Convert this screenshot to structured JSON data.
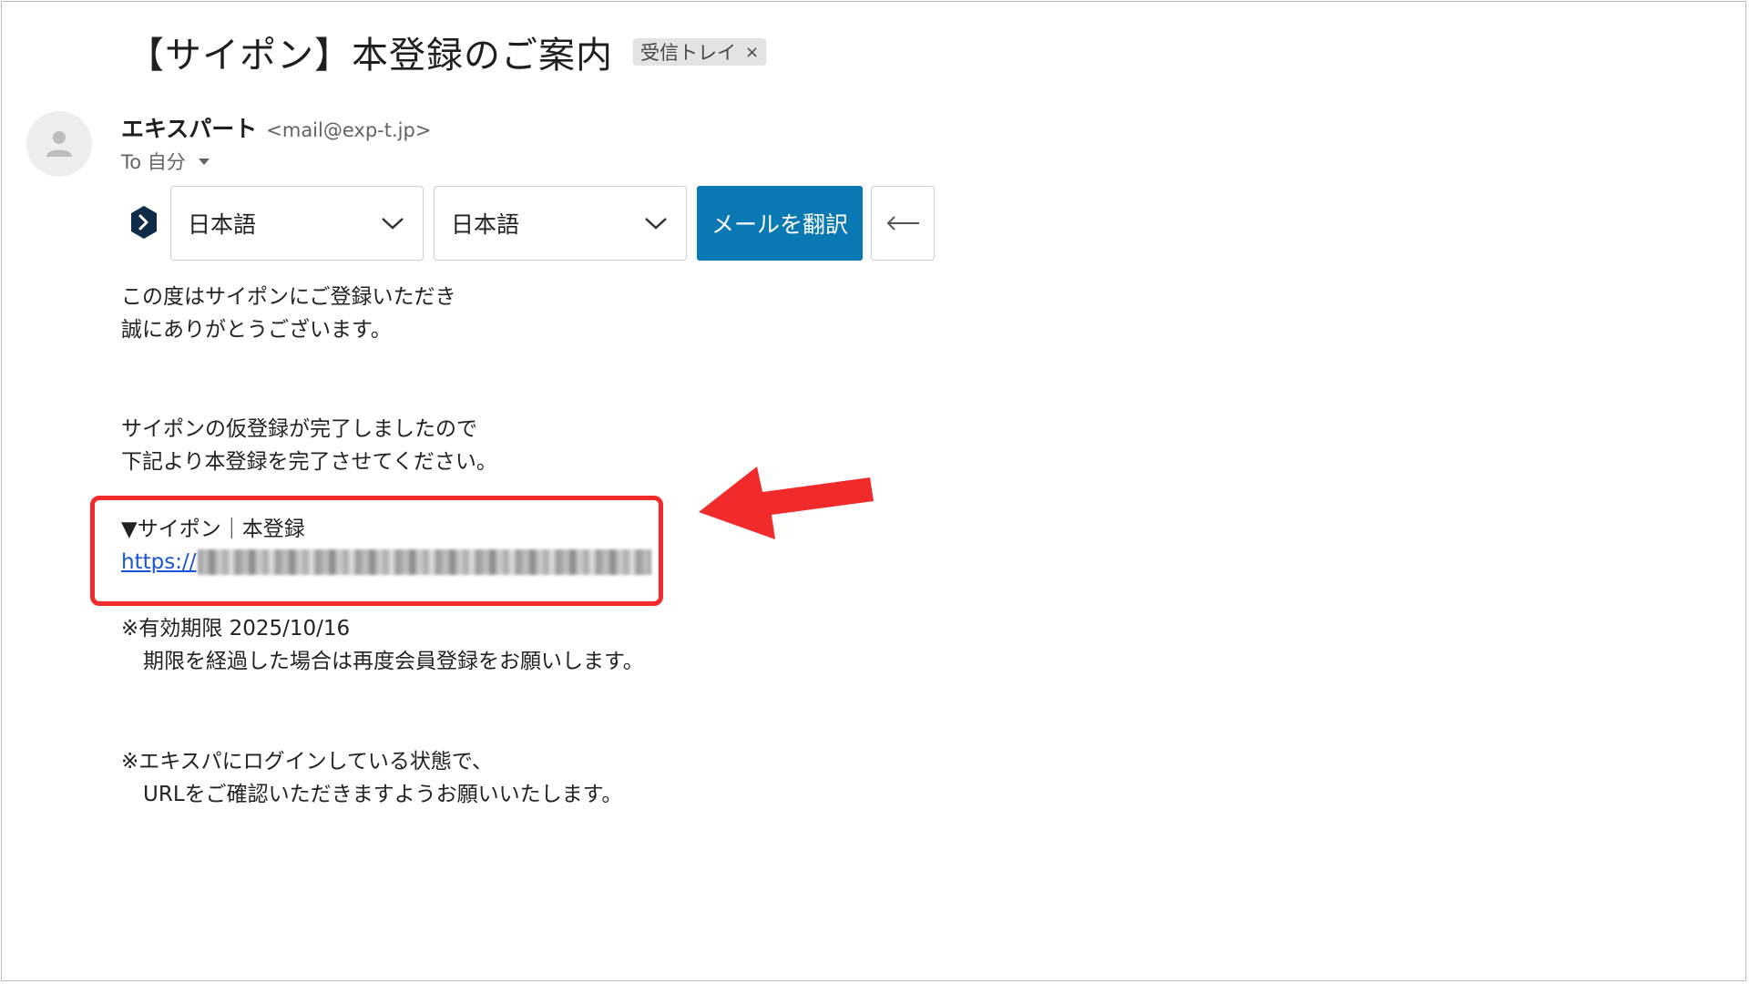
{
  "email": {
    "subject": "【サイポン】本登録のご案内",
    "label_chip": "受信トレイ",
    "label_chip_close": "×",
    "sender_name": "エキスパート",
    "sender_email": "<mail@exp-t.jp>",
    "to_label": "To 自分"
  },
  "translate_bar": {
    "icon": "deepl-icon",
    "source_language": "日本語",
    "target_language": "日本語",
    "translate_button": "メールを翻訳",
    "back_icon": "arrow-left-icon",
    "accent_color": "#0a78b3"
  },
  "body": {
    "para1_line1": "この度はサイポンにご登録いただき",
    "para1_line2": "誠にありがとうございます。",
    "para2_line1": "サイポンの仮登録が完了しましたので",
    "para2_line2": "下記より本登録を完了させてください。",
    "link_heading": "▼サイポン｜本登録",
    "link_prefix": "https://",
    "expiry_line1": "※有効期限 2025/10/16",
    "expiry_line2": "期限を経過した場合は再度会員登録をお願いします。",
    "note_line1": "※エキスパにログインしている状態で、",
    "note_line2": "URLをご確認いただきますようお願いいたします。"
  },
  "annotation": {
    "highlight_color": "#f12b2b",
    "arrow_icon": "red-arrow-icon"
  }
}
